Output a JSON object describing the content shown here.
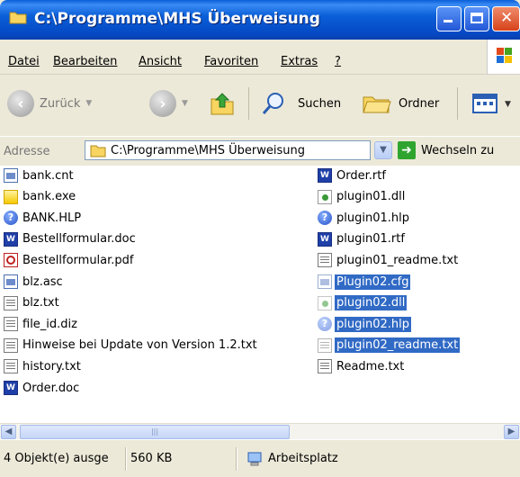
{
  "window": {
    "title": "C:\\Programme\\MHS Überweisung"
  },
  "menu": [
    {
      "label": "Datei"
    },
    {
      "label": "Bearbeiten"
    },
    {
      "label": "Ansicht"
    },
    {
      "label": "Favoriten"
    },
    {
      "label": "Extras"
    },
    {
      "label": "?"
    }
  ],
  "toolbar": {
    "back": "Zurück",
    "search": "Suchen",
    "folders": "Ordner"
  },
  "address": {
    "label": "Adresse",
    "value": "C:\\Programme\\MHS Überweisung",
    "go": "Wechseln zu"
  },
  "files": {
    "left": [
      {
        "name": "bank.cnt",
        "icon": "cnt"
      },
      {
        "name": "bank.exe",
        "icon": "exe"
      },
      {
        "name": "BANK.HLP",
        "icon": "help"
      },
      {
        "name": "Bestellformular.doc",
        "icon": "word"
      },
      {
        "name": "Bestellformular.pdf",
        "icon": "pdf"
      },
      {
        "name": "blz.asc",
        "icon": "cnt"
      },
      {
        "name": "blz.txt",
        "icon": "doc"
      },
      {
        "name": "file_id.diz",
        "icon": "doc"
      },
      {
        "name": "Hinweise bei Update von Version 1.2.txt",
        "icon": "doc"
      },
      {
        "name": "history.txt",
        "icon": "doc"
      },
      {
        "name": "Order.doc",
        "icon": "word"
      }
    ],
    "right": [
      {
        "name": "Order.rtf",
        "icon": "word",
        "selected": false
      },
      {
        "name": "plugin01.dll",
        "icon": "dll",
        "selected": false
      },
      {
        "name": "plugin01.hlp",
        "icon": "help",
        "selected": false
      },
      {
        "name": "plugin01.rtf",
        "icon": "word",
        "selected": false
      },
      {
        "name": "plugin01_readme.txt",
        "icon": "doc",
        "selected": false
      },
      {
        "name": "Plugin02.cfg",
        "icon": "cnt",
        "selected": true
      },
      {
        "name": "plugin02.dll",
        "icon": "dll",
        "selected": true
      },
      {
        "name": "plugin02.hlp",
        "icon": "help",
        "selected": true
      },
      {
        "name": "plugin02_readme.txt",
        "icon": "doc",
        "selected": true
      },
      {
        "name": "Readme.txt",
        "icon": "doc",
        "selected": false
      }
    ]
  },
  "status": {
    "objects": "4 Objekt(e) ausge",
    "size": "560 KB",
    "location": "Arbeitsplatz"
  },
  "colors": {
    "titlebar": "#0A5FD8",
    "selection": "#316AC5",
    "chrome": "#ECE9D8"
  }
}
